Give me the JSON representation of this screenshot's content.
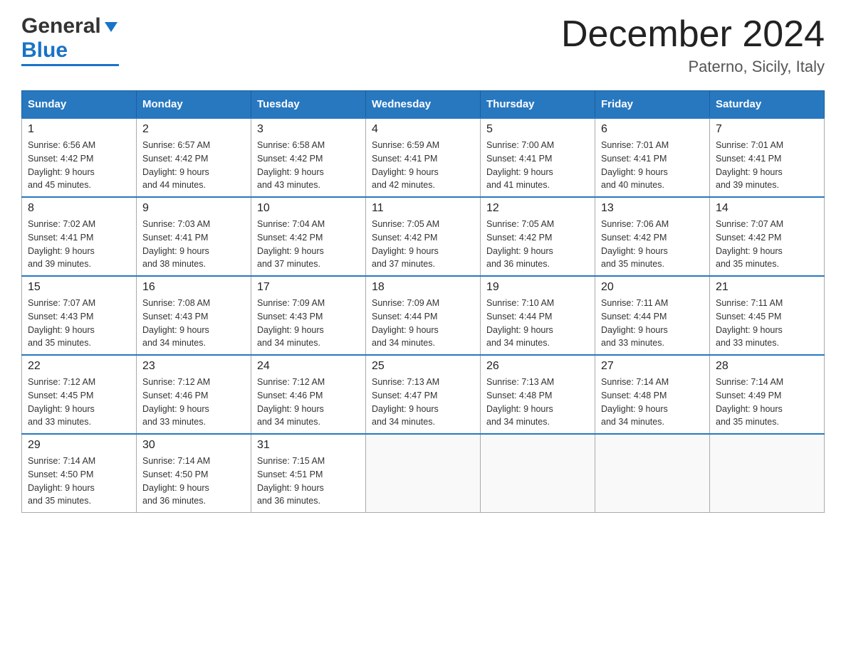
{
  "header": {
    "logo_general": "General",
    "logo_blue": "Blue",
    "month_title": "December 2024",
    "location": "Paterno, Sicily, Italy"
  },
  "days_of_week": [
    "Sunday",
    "Monday",
    "Tuesday",
    "Wednesday",
    "Thursday",
    "Friday",
    "Saturday"
  ],
  "weeks": [
    [
      {
        "day": "1",
        "sunrise": "6:56 AM",
        "sunset": "4:42 PM",
        "daylight": "9 hours and 45 minutes."
      },
      {
        "day": "2",
        "sunrise": "6:57 AM",
        "sunset": "4:42 PM",
        "daylight": "9 hours and 44 minutes."
      },
      {
        "day": "3",
        "sunrise": "6:58 AM",
        "sunset": "4:42 PM",
        "daylight": "9 hours and 43 minutes."
      },
      {
        "day": "4",
        "sunrise": "6:59 AM",
        "sunset": "4:41 PM",
        "daylight": "9 hours and 42 minutes."
      },
      {
        "day": "5",
        "sunrise": "7:00 AM",
        "sunset": "4:41 PM",
        "daylight": "9 hours and 41 minutes."
      },
      {
        "day": "6",
        "sunrise": "7:01 AM",
        "sunset": "4:41 PM",
        "daylight": "9 hours and 40 minutes."
      },
      {
        "day": "7",
        "sunrise": "7:01 AM",
        "sunset": "4:41 PM",
        "daylight": "9 hours and 39 minutes."
      }
    ],
    [
      {
        "day": "8",
        "sunrise": "7:02 AM",
        "sunset": "4:41 PM",
        "daylight": "9 hours and 39 minutes."
      },
      {
        "day": "9",
        "sunrise": "7:03 AM",
        "sunset": "4:41 PM",
        "daylight": "9 hours and 38 minutes."
      },
      {
        "day": "10",
        "sunrise": "7:04 AM",
        "sunset": "4:42 PM",
        "daylight": "9 hours and 37 minutes."
      },
      {
        "day": "11",
        "sunrise": "7:05 AM",
        "sunset": "4:42 PM",
        "daylight": "9 hours and 37 minutes."
      },
      {
        "day": "12",
        "sunrise": "7:05 AM",
        "sunset": "4:42 PM",
        "daylight": "9 hours and 36 minutes."
      },
      {
        "day": "13",
        "sunrise": "7:06 AM",
        "sunset": "4:42 PM",
        "daylight": "9 hours and 35 minutes."
      },
      {
        "day": "14",
        "sunrise": "7:07 AM",
        "sunset": "4:42 PM",
        "daylight": "9 hours and 35 minutes."
      }
    ],
    [
      {
        "day": "15",
        "sunrise": "7:07 AM",
        "sunset": "4:43 PM",
        "daylight": "9 hours and 35 minutes."
      },
      {
        "day": "16",
        "sunrise": "7:08 AM",
        "sunset": "4:43 PM",
        "daylight": "9 hours and 34 minutes."
      },
      {
        "day": "17",
        "sunrise": "7:09 AM",
        "sunset": "4:43 PM",
        "daylight": "9 hours and 34 minutes."
      },
      {
        "day": "18",
        "sunrise": "7:09 AM",
        "sunset": "4:44 PM",
        "daylight": "9 hours and 34 minutes."
      },
      {
        "day": "19",
        "sunrise": "7:10 AM",
        "sunset": "4:44 PM",
        "daylight": "9 hours and 34 minutes."
      },
      {
        "day": "20",
        "sunrise": "7:11 AM",
        "sunset": "4:44 PM",
        "daylight": "9 hours and 33 minutes."
      },
      {
        "day": "21",
        "sunrise": "7:11 AM",
        "sunset": "4:45 PM",
        "daylight": "9 hours and 33 minutes."
      }
    ],
    [
      {
        "day": "22",
        "sunrise": "7:12 AM",
        "sunset": "4:45 PM",
        "daylight": "9 hours and 33 minutes."
      },
      {
        "day": "23",
        "sunrise": "7:12 AM",
        "sunset": "4:46 PM",
        "daylight": "9 hours and 33 minutes."
      },
      {
        "day": "24",
        "sunrise": "7:12 AM",
        "sunset": "4:46 PM",
        "daylight": "9 hours and 34 minutes."
      },
      {
        "day": "25",
        "sunrise": "7:13 AM",
        "sunset": "4:47 PM",
        "daylight": "9 hours and 34 minutes."
      },
      {
        "day": "26",
        "sunrise": "7:13 AM",
        "sunset": "4:48 PM",
        "daylight": "9 hours and 34 minutes."
      },
      {
        "day": "27",
        "sunrise": "7:14 AM",
        "sunset": "4:48 PM",
        "daylight": "9 hours and 34 minutes."
      },
      {
        "day": "28",
        "sunrise": "7:14 AM",
        "sunset": "4:49 PM",
        "daylight": "9 hours and 35 minutes."
      }
    ],
    [
      {
        "day": "29",
        "sunrise": "7:14 AM",
        "sunset": "4:50 PM",
        "daylight": "9 hours and 35 minutes."
      },
      {
        "day": "30",
        "sunrise": "7:14 AM",
        "sunset": "4:50 PM",
        "daylight": "9 hours and 36 minutes."
      },
      {
        "day": "31",
        "sunrise": "7:15 AM",
        "sunset": "4:51 PM",
        "daylight": "9 hours and 36 minutes."
      },
      null,
      null,
      null,
      null
    ]
  ]
}
